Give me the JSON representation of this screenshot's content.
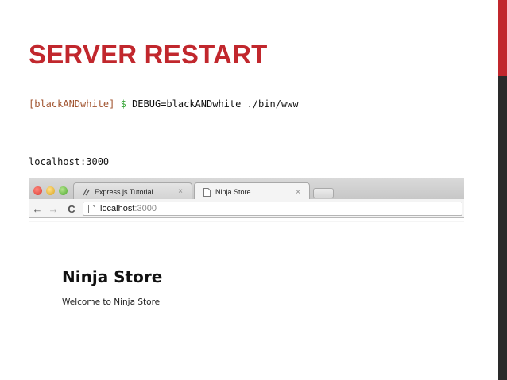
{
  "slide": {
    "title": "SERVER RESTART",
    "command": {
      "prompt": "[blackANDwhite]",
      "dollar": "$",
      "text": "DEBUG=blackANDwhite ./bin/www"
    },
    "host_line": "localhost:3000"
  },
  "colors": {
    "accent": "#c1272d",
    "side_bar": "#2a2a2a",
    "prompt": "#a0522d",
    "dollar": "#3aa63a"
  },
  "browser": {
    "tabs": [
      {
        "label": "Express.js Tutorial",
        "icon": "express-icon",
        "active": false,
        "close": "×"
      },
      {
        "label": "Ninja Store",
        "icon": "page-icon",
        "active": true,
        "close": "×"
      }
    ],
    "nav": {
      "back": "←",
      "forward": "→",
      "reload": "C"
    },
    "address": {
      "host": "localhost",
      "port": ":3000"
    }
  },
  "page": {
    "heading": "Ninja Store",
    "text": "Welcome to Ninja Store"
  }
}
